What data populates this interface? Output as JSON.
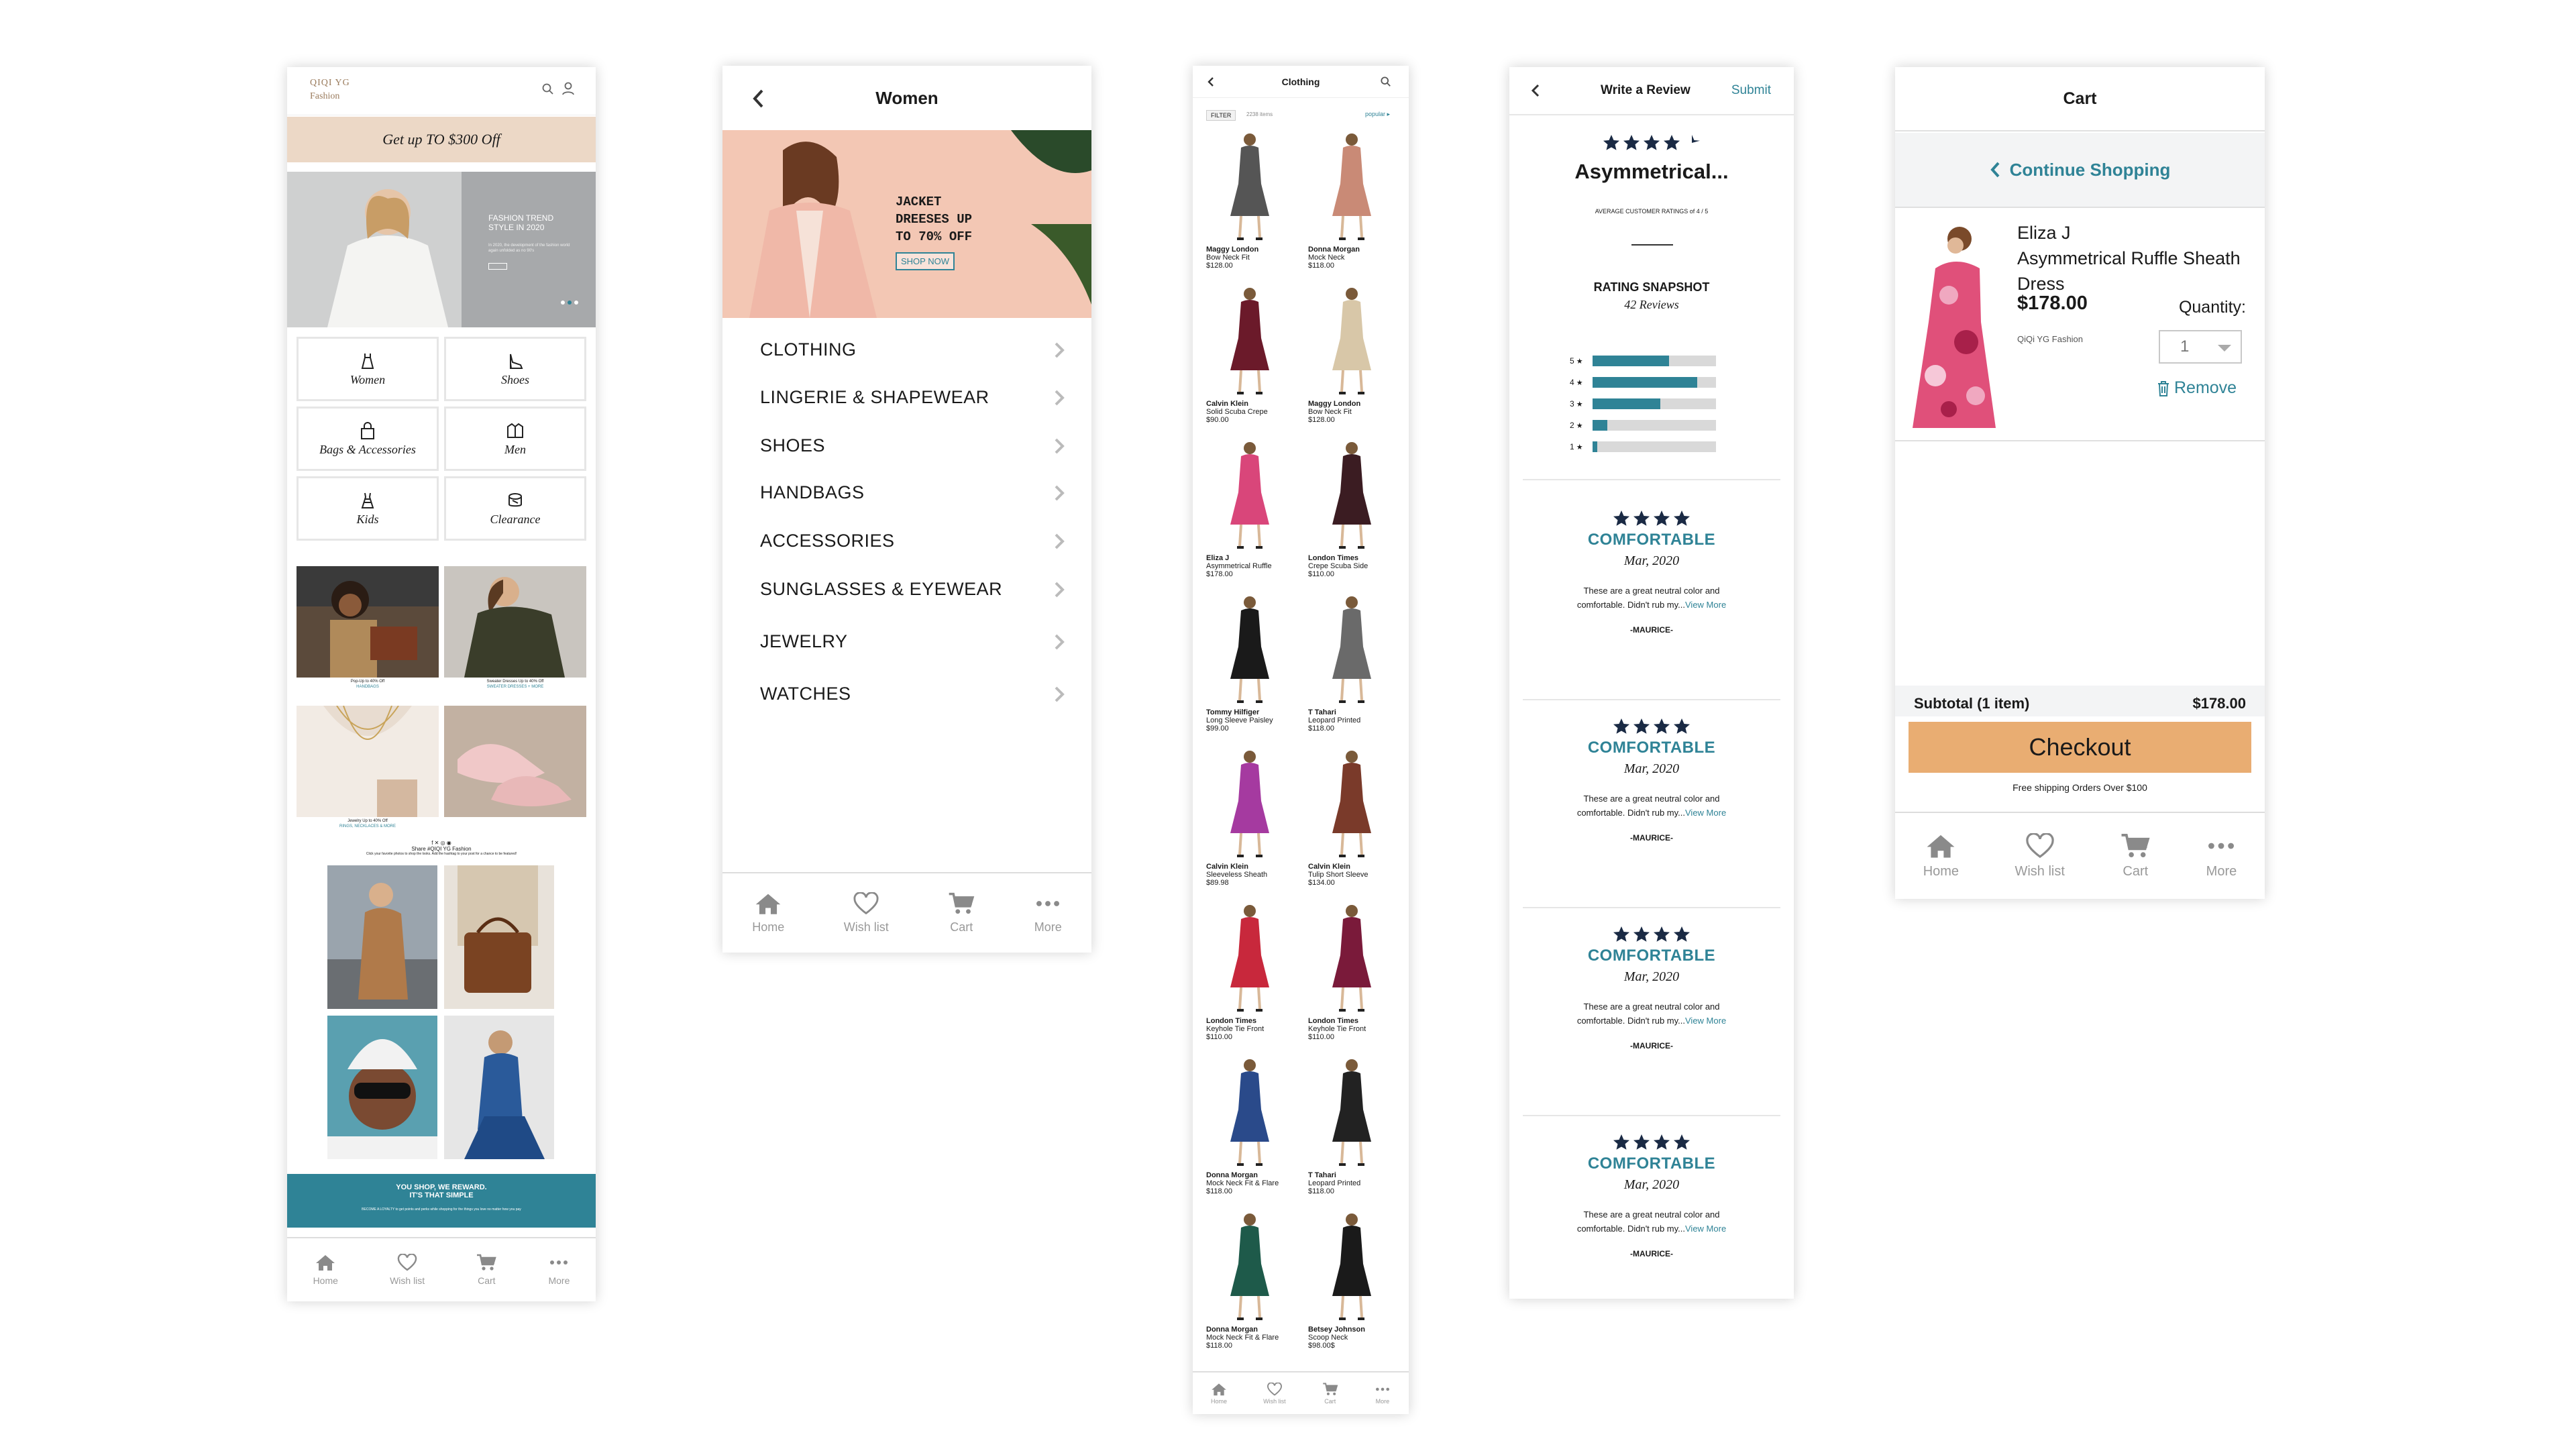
{
  "screen1": {
    "brand_line1": "QIQI YG",
    "brand_line2": "Fashion",
    "promo": "Get up TO $300 Off",
    "hero_title": "FASHION TREND STYLE IN 2020",
    "hero_body": "In 2020, the development of the fashion world again unfolded as no 90's",
    "categories": [
      {
        "label": "Women",
        "icon": "dress-icon"
      },
      {
        "label": "Shoes",
        "icon": "heel-icon"
      },
      {
        "label": "Bags & Accessories",
        "icon": "bag-icon"
      },
      {
        "label": "Men",
        "icon": "shirt-icon"
      },
      {
        "label": "Kids",
        "icon": "kids-dress-icon"
      },
      {
        "label": "Clearance",
        "icon": "tag-icon"
      }
    ],
    "cap1": "Pop-Up to 40% Off",
    "cap1b": "HANDBAGS",
    "cap2": "Sweater Dresses Up to 40% Off",
    "cap2b": "SWEATER DRESSES + MORE",
    "cap3": "Jewelry Up to 40% Off",
    "cap3b": "RINGS, NECKLACES & MORE",
    "social_text": "Share #QIQI YG Fashion",
    "social_body": "Click your favorite photos to shop the looks. Add the hashtag to your post for a chance to be featured!",
    "banner_title1": "YOU SHOP, WE REWARD.",
    "banner_title2": "IT'S THAT SIMPLE",
    "banner_body": "BECOME A LOYALTY to get points and perks while shopping for the things you love no matter how you pay"
  },
  "nav": {
    "home": "Home",
    "wish": "Wish list",
    "cart": "Cart",
    "more": "More"
  },
  "screen2": {
    "title": "Women",
    "hero_line1": "JACKET",
    "hero_line2": "DREESES UP",
    "hero_line3": "TO 70% OFF",
    "hero_btn": "SHOP NOW",
    "menu": [
      "CLOTHING",
      "LINGERIE & SHAPEWEAR",
      "SHOES",
      "HANDBAGS",
      "ACCESSORIES",
      "SUNGLASSES & EYEWEAR",
      "JEWELRY",
      "WATCHES"
    ]
  },
  "screen3": {
    "title": "Clothing",
    "filter": "FILTER",
    "count": "2238 items",
    "sort": "popular ▸",
    "products": [
      {
        "brand": "Maggy London",
        "name": "Bow Neck Fit",
        "price": "$128.00",
        "color": "#555"
      },
      {
        "brand": "Donna Morgan",
        "name": "Mock Neck",
        "price": "$118.00",
        "color": "#c98a76"
      },
      {
        "brand": "Calvin Klein",
        "name": "Solid Scuba Crepe",
        "price": "$90.00",
        "color": "#6b1a2a"
      },
      {
        "brand": "Maggy London",
        "name": "Bow Neck Fit",
        "price": "$128.00",
        "color": "#d8c7a8"
      },
      {
        "brand": "Eliza J",
        "name": "Asymmetrical Ruffle",
        "price": "$178.00",
        "color": "#d9467a"
      },
      {
        "brand": "London Times",
        "name": "Crepe Scuba Side",
        "price": "$110.00",
        "color": "#3b1c22"
      },
      {
        "brand": "Tommy Hilfiger",
        "name": "Long Sleeve Paisley",
        "price": "$99.00",
        "color": "#1a1a1a"
      },
      {
        "brand": "T Tahari",
        "name": "Leopard Printed",
        "price": "$118.00",
        "color": "#6a6a6a"
      },
      {
        "brand": "Calvin Klein",
        "name": "Sleeveless Sheath",
        "price": "$89.98",
        "color": "#a53aa0"
      },
      {
        "brand": "Calvin Klein",
        "name": "Tulip Short Sleeve",
        "price": "$134.00",
        "color": "#7a3a2a"
      },
      {
        "brand": "London Times",
        "name": "Keyhole Tie Front",
        "price": "$110.00",
        "color": "#c8283c"
      },
      {
        "brand": "London Times",
        "name": "Keyhole Tie Front",
        "price": "$110.00",
        "color": "#7a1a3a"
      },
      {
        "brand": "Donna Morgan",
        "name": "Mock Neck Fit & Flare",
        "price": "$118.00",
        "color": "#2a4a8a"
      },
      {
        "brand": "T Tahari",
        "name": "Leopard Printed",
        "price": "$118.00",
        "color": "#222"
      },
      {
        "brand": "Donna Morgan",
        "name": "Mock Neck Fit & Flare",
        "price": "$118.00",
        "color": "#1e5a4a"
      },
      {
        "brand": "Betsey Johnson",
        "name": "Scoop Neck",
        "price": "$98.00$",
        "color": "#1a1a1a"
      }
    ]
  },
  "screen4": {
    "title": "Write a Review",
    "submit": "Submit",
    "product": "Asymmetrical...",
    "avg": "AVERAGE CUSTOMER RATINGS of 4 / 5",
    "snapshot": "RATING SNAPSHOT",
    "reviews_count": "42 Reviews",
    "bars": [
      {
        "label": "5",
        "value": 0.62
      },
      {
        "label": "4",
        "value": 0.85
      },
      {
        "label": "3",
        "value": 0.55
      },
      {
        "label": "2",
        "value": 0.12
      },
      {
        "label": "1",
        "value": 0.04
      }
    ],
    "reviews": [
      {
        "title": "COMFORTABLE",
        "date": "Mar, 2020",
        "body1": "These are a great neutral color and",
        "body2": "comfortable. Didn't rub my...",
        "more": "View More",
        "user": "-MAURICE-"
      },
      {
        "title": "COMFORTABLE",
        "date": "Mar, 2020",
        "body1": "These are a great neutral color and",
        "body2": "comfortable. Didn't rub my...",
        "more": "View More",
        "user": "-MAURICE-"
      },
      {
        "title": "COMFORTABLE",
        "date": "Mar, 2020",
        "body1": "These are a great neutral color and",
        "body2": "comfortable. Didn't rub my...",
        "more": "View More",
        "user": "-MAURICE-"
      },
      {
        "title": "COMFORTABLE",
        "date": "Mar, 2020",
        "body1": "These are a great neutral color and",
        "body2": "comfortable. Didn't rub my...",
        "more": "View More",
        "user": "-MAURICE-"
      }
    ]
  },
  "screen5": {
    "title": "Cart",
    "continue": "Continue Shopping",
    "brand": "Eliza J",
    "name": "Asymmetrical Ruffle Sheath Dress",
    "price": "$178.00",
    "qty_label": "Quantity:",
    "seller": "QiQi YG Fashion",
    "qty": "1",
    "remove": "Remove",
    "subtotal_label": "Subtotal (1 item)",
    "subtotal": "$178.00",
    "checkout": "Checkout",
    "shipping": "Free shipping Orders Over $100"
  },
  "colors": {
    "teal": "#2f8396",
    "checkout": "#e9ad72",
    "promo_bg": "#ecd8c6",
    "navy": "#1a2a44"
  }
}
